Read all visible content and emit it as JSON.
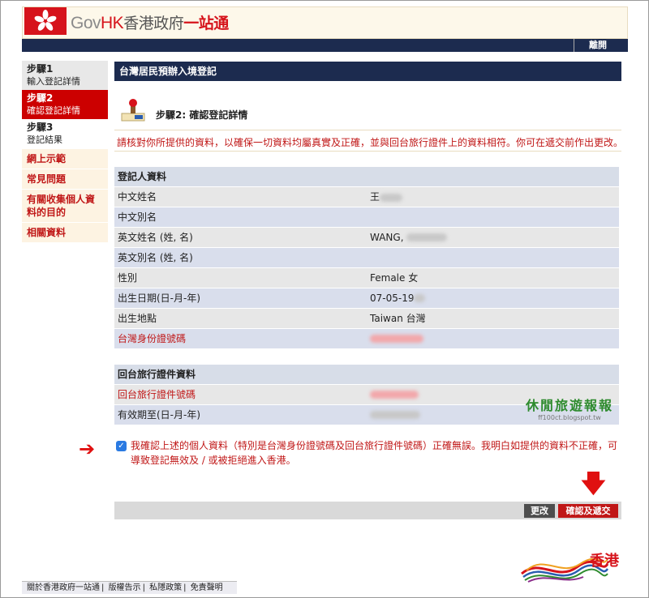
{
  "header": {
    "logo_gov": "Gov",
    "logo_hk": "HK",
    "logo_zh": "香港政府",
    "logo_zh_brand": "一站通",
    "logout": "離開"
  },
  "sidebar": {
    "steps": [
      {
        "title": "步驟1",
        "subtitle": "輸入登記詳情"
      },
      {
        "title": "步驟2",
        "subtitle": "確認登記詳情"
      },
      {
        "title": "步驟3",
        "subtitle": "登記結果"
      }
    ],
    "links": [
      "網上示範",
      "常見問題",
      "有關收集個人資料的目的",
      "相關資料"
    ]
  },
  "main": {
    "title": "台灣居民預辦入境登記",
    "step_heading": "步驟2: 確認登記詳情",
    "notice": "請核對你所提供的資料，以確保一切資料均屬真實及正確，並與回台旅行證件上的資料相符。你可在遞交前作出更改。",
    "registrant_section": "登記人資料",
    "registrant_rows": [
      {
        "label": "中文姓名",
        "value": "王"
      },
      {
        "label": "中文別名",
        "value": ""
      },
      {
        "label": "英文姓名 (姓, 名)",
        "value": "WANG,"
      },
      {
        "label": "英文別名 (姓, 名)",
        "value": ""
      },
      {
        "label": "性別",
        "value": "Female 女"
      },
      {
        "label": "出生日期(日-月-年)",
        "value": "07-05-19"
      },
      {
        "label": "出生地點",
        "value": "Taiwan 台灣"
      },
      {
        "label": "台灣身份證號碼",
        "value": ""
      }
    ],
    "travel_section": "回台旅行證件資料",
    "travel_rows": [
      {
        "label": "回台旅行證件號碼",
        "value": ""
      },
      {
        "label": "有效期至(日-月-年)",
        "value": ""
      }
    ],
    "confirm_text": "我確認上述的個人資料（特別是台灣身份證號碼及回台旅行證件號碼）正確無誤。我明白如提供的資料不正確，可導致登記無效及 / 或被拒絕進入香港。",
    "edit_button": "更改",
    "submit_button": "確認及遞交"
  },
  "watermark": {
    "name": "休閒旅遊報報",
    "url": "ff100ct.blogspot.tw"
  },
  "brand_logo": "香港",
  "footer": {
    "links": [
      "關於香港政府一站通",
      "版權告示",
      "私隱政策",
      "免責聲明"
    ]
  },
  "colors": {
    "navy": "#1c2b4f",
    "red": "#c01717",
    "row_grey": "#e7e7e7",
    "row_blue": "#d9deec"
  }
}
